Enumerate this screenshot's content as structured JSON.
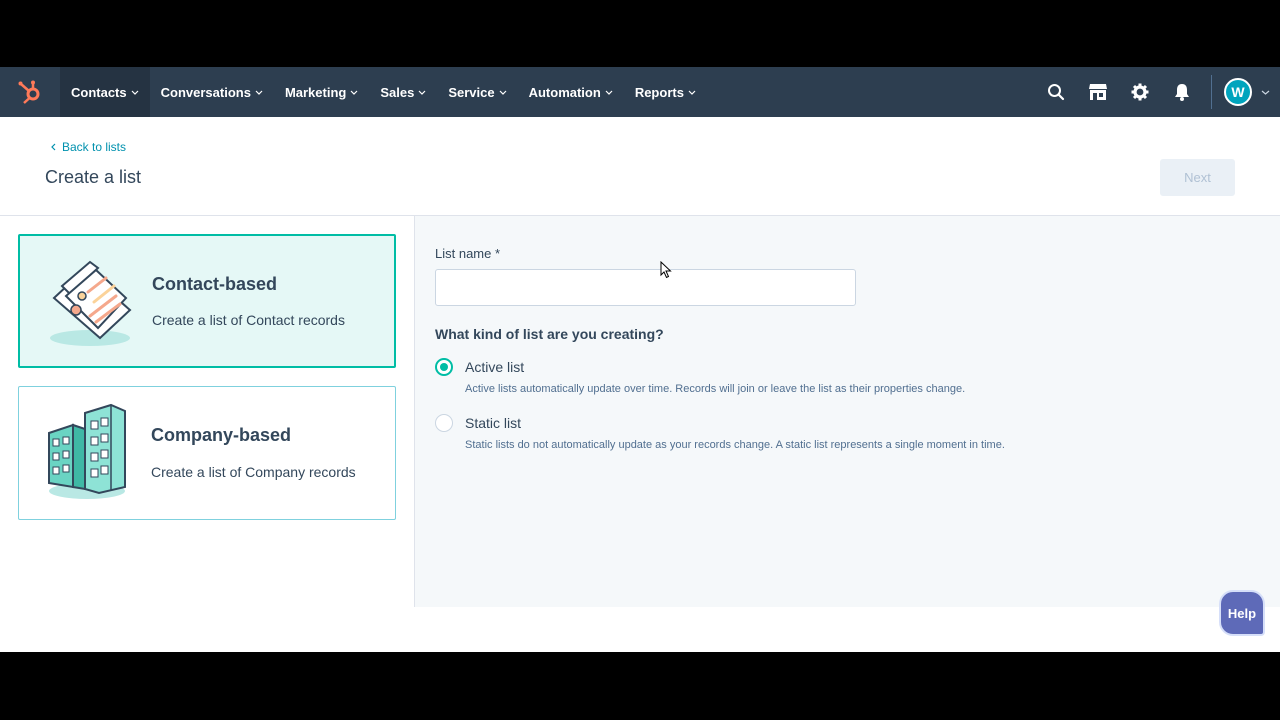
{
  "nav": {
    "items": [
      {
        "label": "Contacts",
        "active": true
      },
      {
        "label": "Conversations"
      },
      {
        "label": "Marketing"
      },
      {
        "label": "Sales"
      },
      {
        "label": "Service"
      },
      {
        "label": "Automation"
      },
      {
        "label": "Reports"
      }
    ],
    "avatar_initial": "W",
    "icons": [
      "search-icon",
      "marketplace-icon",
      "gear-icon",
      "bell-icon"
    ]
  },
  "header": {
    "back_label": "Back to lists",
    "title": "Create a list",
    "next_label": "Next"
  },
  "types": [
    {
      "title": "Contact-based",
      "desc": "Create a list of Contact records",
      "selected": true
    },
    {
      "title": "Company-based",
      "desc": "Create a list of Company records",
      "selected": false
    }
  ],
  "form": {
    "list_name_label": "List name *",
    "list_name_value": "",
    "question": "What kind of list are you creating?",
    "options": [
      {
        "label": "Active list",
        "help": "Active lists automatically update over time. Records will join or leave the list as their properties change.",
        "checked": true
      },
      {
        "label": "Static list",
        "help": "Static lists do not automatically update as your records change. A static list represents a single moment in time.",
        "checked": false
      }
    ]
  },
  "help_label": "Help",
  "colors": {
    "nav_bg": "#2d3e50",
    "accent": "#00bda5",
    "link": "#0091ae",
    "logo": "#ff7a59"
  }
}
